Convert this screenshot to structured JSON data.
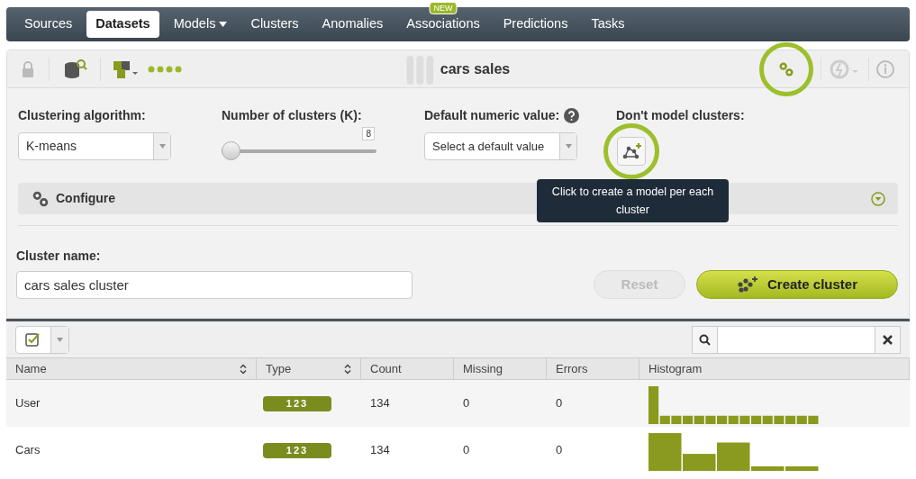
{
  "nav": {
    "items": [
      {
        "label": "Sources",
        "selected": false
      },
      {
        "label": "Datasets",
        "selected": true
      },
      {
        "label": "Models",
        "selected": false,
        "dropdown": true
      },
      {
        "label": "Clusters",
        "selected": false
      },
      {
        "label": "Anomalies",
        "selected": false
      },
      {
        "label": "Associations",
        "selected": false,
        "badge": "NEW"
      },
      {
        "label": "Predictions",
        "selected": false
      },
      {
        "label": "Tasks",
        "selected": false
      }
    ]
  },
  "toolbar": {
    "title": "cars sales",
    "config_highlighted": true
  },
  "form": {
    "algorithm": {
      "label": "Clustering algorithm:",
      "value": "K-means"
    },
    "k": {
      "label": "Number of clusters (K):",
      "reading": "8",
      "level": 0
    },
    "default_numeric": {
      "label": "Default numeric value:",
      "placeholder": "Select a default value"
    },
    "model_clusters": {
      "label": "Don't model clusters:",
      "highlighted": true,
      "tooltip": "Click to create a model per each cluster"
    },
    "configure": {
      "label": "Configure",
      "expanded": false
    },
    "name": {
      "label": "Cluster name:",
      "value": "cars sales cluster"
    },
    "reset": {
      "label": "Reset",
      "disabled": true
    },
    "create": {
      "label": "Create cluster"
    }
  },
  "table": {
    "columns": [
      {
        "label": "Name",
        "sortable": true
      },
      {
        "label": "Type",
        "sortable": true
      },
      {
        "label": "Count",
        "sortable": false
      },
      {
        "label": "Missing",
        "sortable": false
      },
      {
        "label": "Errors",
        "sortable": false
      },
      {
        "label": "Histogram",
        "sortable": false
      }
    ],
    "rows": [
      {
        "name": "User",
        "type": "123",
        "count": "134",
        "missing": "0",
        "errors": "0"
      },
      {
        "name": "Cars",
        "type": "123",
        "count": "134",
        "missing": "0",
        "errors": "0"
      }
    ]
  }
}
